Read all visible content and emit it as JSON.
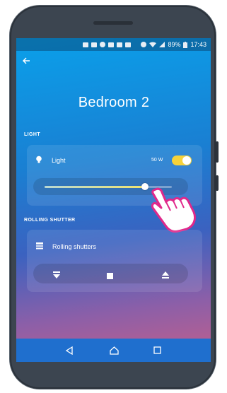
{
  "status_bar": {
    "battery": "89%",
    "time": "17:43"
  },
  "room": {
    "title": "Bedroom 2"
  },
  "light_section": {
    "label": "LIGHT",
    "device_name": "Light",
    "power": "50 W",
    "toggle_on": true,
    "brightness_fraction": 0.79
  },
  "shutter_section": {
    "label": "ROLLING SHUTTER",
    "device_name": "Rolling shutters"
  },
  "colors": {
    "accent_toggle": "#f6d23a",
    "hand_outline": "#e0288b",
    "navbar": "#1f6fce"
  },
  "icons": {
    "back": "arrow-left-icon",
    "light": "bulb-icon",
    "shutter": "shutter-icon",
    "down": "shutter-down-icon",
    "stop": "stop-icon",
    "up": "shutter-up-icon",
    "nav_back": "nav-back-icon",
    "nav_home": "nav-home-icon",
    "nav_recent": "nav-recents-icon"
  }
}
